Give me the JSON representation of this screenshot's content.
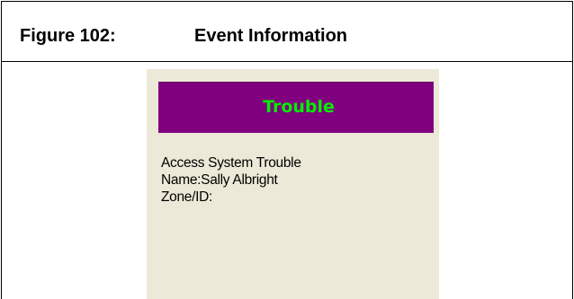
{
  "figure": {
    "number": "Figure 102:",
    "title": "Event Information"
  },
  "event_panel": {
    "banner_label": "Trouble",
    "colors": {
      "banner_background": "#800080",
      "banner_text": "#00f000",
      "panel_background": "#ece9d8"
    },
    "lines": [
      "Access System Trouble",
      "Name:Sally Albright",
      "Zone/ID:"
    ]
  }
}
